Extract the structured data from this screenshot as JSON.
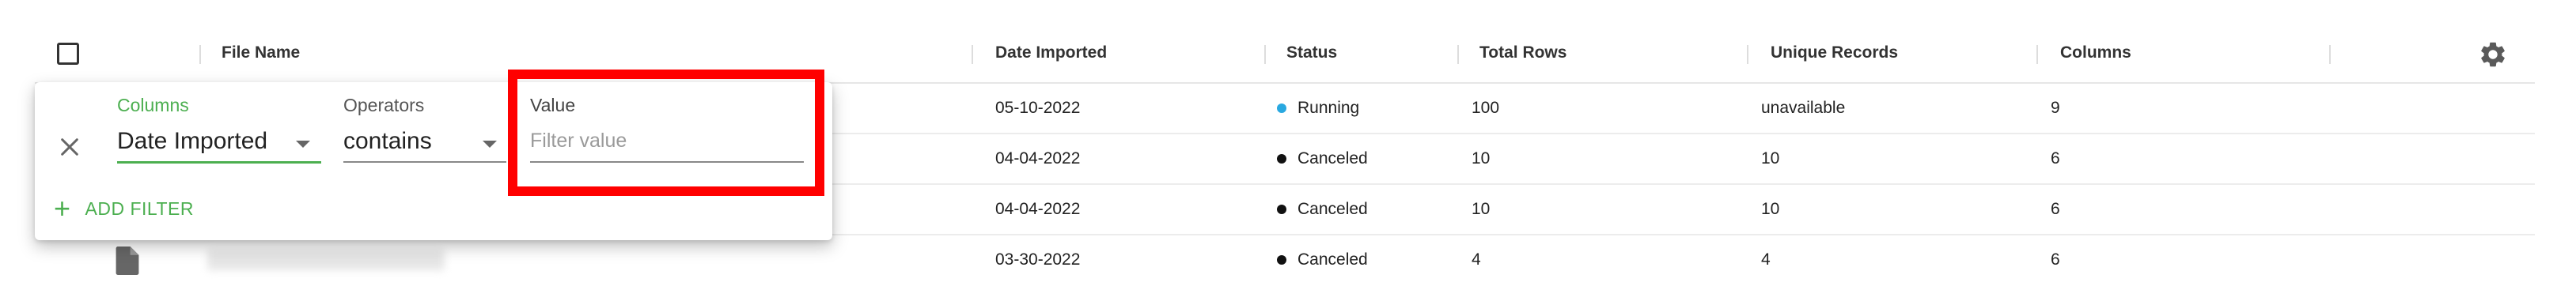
{
  "table": {
    "columns": [
      "File Name",
      "Date Imported",
      "Status",
      "Total Rows",
      "Unique Records",
      "Columns"
    ],
    "rows": [
      {
        "date": "05-10-2022",
        "status": "Running",
        "status_color": "#29a8e0",
        "total": "100",
        "unique": "unavailable",
        "cols": "9"
      },
      {
        "date": "04-04-2022",
        "status": "Canceled",
        "status_color": "#111111",
        "total": "10",
        "unique": "10",
        "cols": "6"
      },
      {
        "date": "04-04-2022",
        "status": "Canceled",
        "status_color": "#111111",
        "total": "10",
        "unique": "10",
        "cols": "6"
      },
      {
        "date": "03-30-2022",
        "status": "Canceled",
        "status_color": "#111111",
        "total": "4",
        "unique": "4",
        "cols": "6"
      }
    ]
  },
  "filter": {
    "columns_label": "Columns",
    "columns_value": "Date Imported",
    "operators_label": "Operators",
    "operators_value": "contains",
    "value_label": "Value",
    "value_placeholder": "Filter value",
    "add_filter_label": "ADD FILTER"
  },
  "icons": [
    "checkbox-icon",
    "settings-gear-icon",
    "file-icon",
    "close-icon",
    "plus-icon",
    "dropdown-arrow-icon"
  ],
  "colors": {
    "accent_green": "#4caf50",
    "highlight_red": "#ff0000",
    "running_blue": "#29a8e0"
  }
}
